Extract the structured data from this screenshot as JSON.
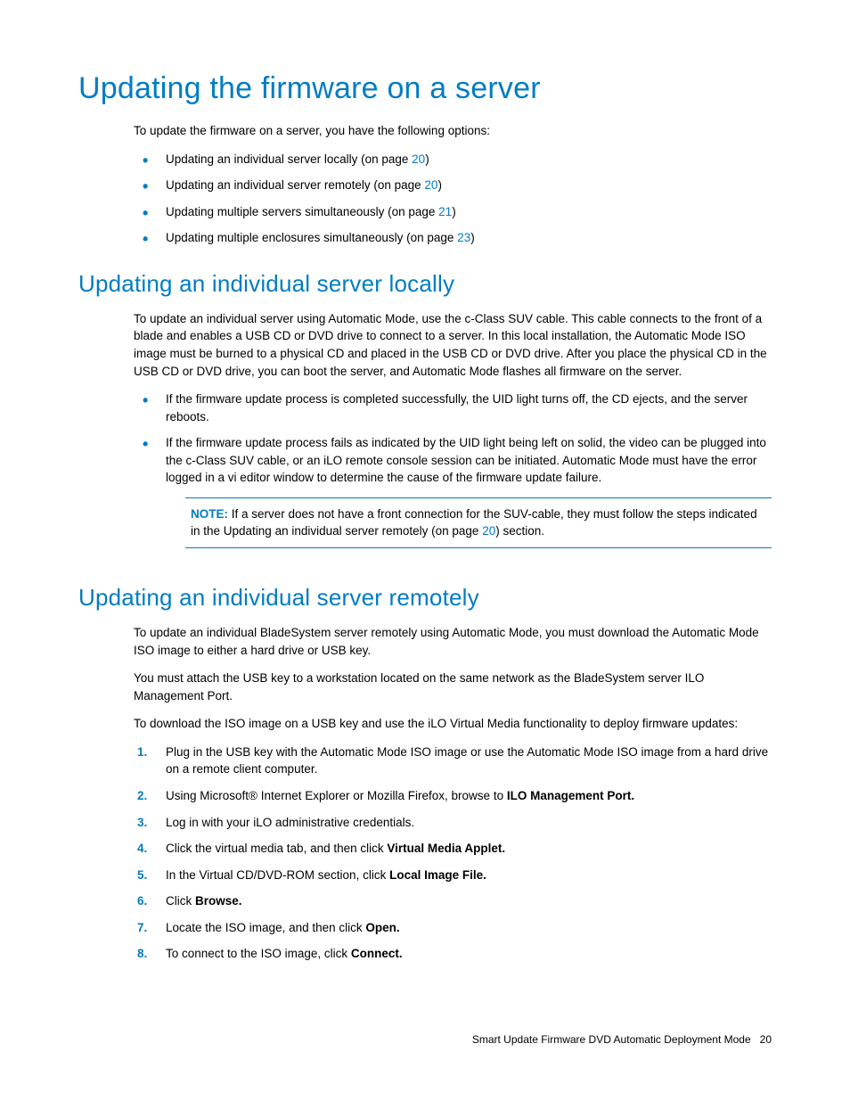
{
  "h1": "Updating the firmware on a server",
  "intro": "To update the firmware on a server, you have the following options:",
  "top_bullets": [
    {
      "pre": "Updating an individual server locally (on page ",
      "link": "20",
      "post": ")"
    },
    {
      "pre": "Updating an individual server remotely (on page ",
      "link": "20",
      "post": ")"
    },
    {
      "pre": "Updating multiple servers simultaneously (on page ",
      "link": "21",
      "post": ")"
    },
    {
      "pre": "Updating multiple enclosures simultaneously (on page ",
      "link": "23",
      "post": ")"
    }
  ],
  "sec1_h2": "Updating an individual server locally",
  "sec1_p1": "To update an individual server using Automatic Mode, use the c-Class SUV cable. This cable connects to the front of a blade and enables a USB CD or DVD drive to connect to a server. In this local installation, the Automatic Mode ISO image must be burned to a physical CD and placed in the USB CD or DVD drive. After you place the physical CD in the USB CD or DVD drive, you can boot the server, and Automatic Mode flashes all firmware on the server.",
  "sec1_bullets": [
    "If the firmware update process is completed successfully, the UID light turns off, the CD ejects, and the server reboots.",
    "If the firmware update process fails as indicated by the UID light being left on solid, the video can be plugged into the c-Class SUV cable, or an iLO remote console session can be initiated. Automatic Mode must have the error logged in a vi editor window to determine the cause of the firmware update failure."
  ],
  "note_label": "NOTE:",
  "note_pre": "  If a server does not have a front connection for the SUV-cable, they must follow the steps indicated in the Updating an individual server remotely (on page ",
  "note_link": "20",
  "note_post": ") section.",
  "sec2_h2": "Updating an individual server remotely",
  "sec2_p1": "To update an individual BladeSystem server remotely using Automatic Mode, you must download the Automatic Mode ISO image to either a hard drive or USB key.",
  "sec2_p2": "You must attach the USB key to a workstation located on the same network as the BladeSystem server ILO Management Port.",
  "sec2_p3": "To download the ISO image on a USB key and use the iLO Virtual Media functionality to deploy firmware updates:",
  "steps": [
    {
      "t1": "Plug in the USB key with the Automatic Mode ISO image or use the Automatic Mode ISO image from a hard drive on a remote client computer.",
      "b": "",
      "t2": ""
    },
    {
      "t1": "Using Microsoft® Internet Explorer or Mozilla Firefox, browse to ",
      "b": "ILO Management Port.",
      "t2": ""
    },
    {
      "t1": "Log in with your iLO administrative credentials.",
      "b": "",
      "t2": ""
    },
    {
      "t1": "Click the virtual media tab, and then click ",
      "b": "Virtual Media Applet.",
      "t2": ""
    },
    {
      "t1": "In the Virtual CD/DVD-ROM section, click ",
      "b": "Local Image File.",
      "t2": ""
    },
    {
      "t1": "Click ",
      "b": "Browse.",
      "t2": ""
    },
    {
      "t1": "Locate the ISO image, and then click ",
      "b": "Open.",
      "t2": ""
    },
    {
      "t1": "To connect to the ISO image, click ",
      "b": "Connect.",
      "t2": ""
    }
  ],
  "footer_text": "Smart Update Firmware DVD Automatic Deployment Mode",
  "footer_page": "20"
}
